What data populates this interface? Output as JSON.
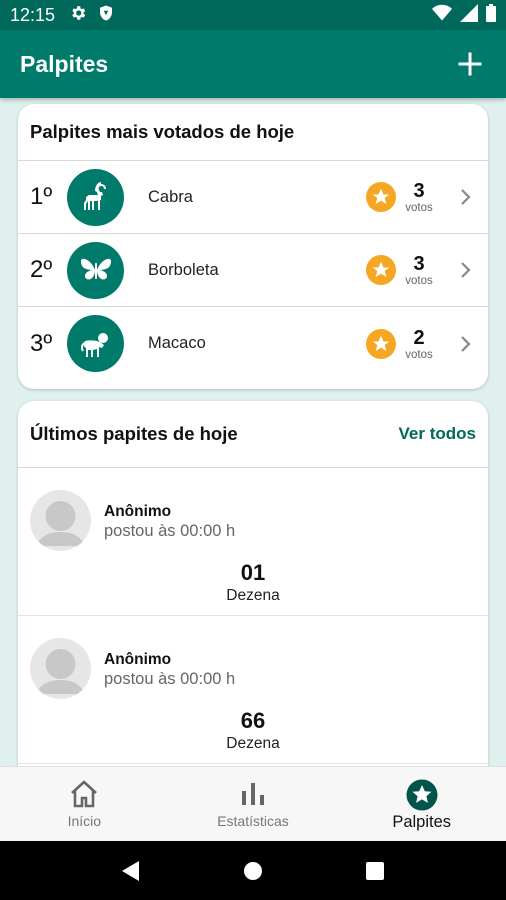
{
  "status_bar": {
    "time": "12:15",
    "left_icons": [
      "gear-icon",
      "shield-icon"
    ],
    "right_icons": [
      "wifi-icon",
      "signal-icon",
      "battery-icon"
    ]
  },
  "app_bar": {
    "title": "Palpites",
    "action_icon": "plus-icon"
  },
  "top_card": {
    "title": "Palpites mais votados de hoje",
    "rows": [
      {
        "position": "1º",
        "animal": "Cabra",
        "animal_icon": "goat-icon",
        "votes": "3",
        "votes_label": "votos"
      },
      {
        "position": "2º",
        "animal": "Borboleta",
        "animal_icon": "butterfly-icon",
        "votes": "3",
        "votes_label": "votos"
      },
      {
        "position": "3º",
        "animal": "Macaco",
        "animal_icon": "monkey-icon",
        "votes": "2",
        "votes_label": "votos"
      }
    ]
  },
  "latest_card": {
    "title": "Últimos papites de hoje",
    "see_all": "Ver todos",
    "posts": [
      {
        "user": "Anônimo",
        "time": "postou às 00:00 h",
        "number": "01",
        "type": "Dezena"
      },
      {
        "user": "Anônimo",
        "time": "postou às 00:00 h",
        "number": "66",
        "type": "Dezena"
      }
    ]
  },
  "bottom_nav": {
    "items": [
      {
        "label": "Início",
        "icon": "home-icon",
        "active": false
      },
      {
        "label": "Estatísticas",
        "icon": "bar-chart-icon",
        "active": false
      },
      {
        "label": "Palpites",
        "icon": "star-icon",
        "active": true
      }
    ]
  },
  "colors": {
    "primary": "#007a6b",
    "status_bar": "#00695c",
    "accent_star": "#f5a623",
    "background": "#e0f0ee"
  }
}
